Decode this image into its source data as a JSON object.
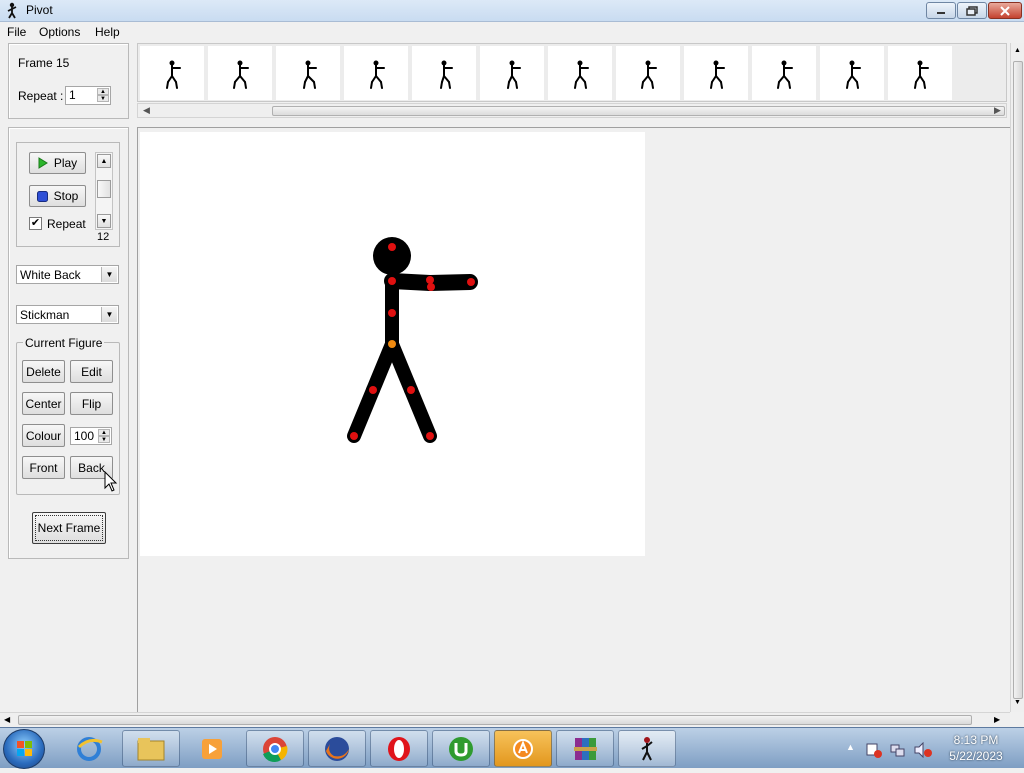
{
  "window": {
    "title": "Pivot"
  },
  "menu": [
    "File",
    "Options",
    "Help"
  ],
  "frame_panel": {
    "frame_label": "Frame 15",
    "repeat_label": "Repeat :",
    "repeat_value": "1"
  },
  "playback": {
    "play": "Play",
    "stop": "Stop",
    "repeat_checkbox": "Repeat",
    "repeat_checked": true,
    "speed_value": "12"
  },
  "background_select": {
    "value": "White Back"
  },
  "figure_select": {
    "value": "Stickman"
  },
  "current_figure": {
    "legend": "Current Figure",
    "delete": "Delete",
    "edit": "Edit",
    "center": "Center",
    "flip": "Flip",
    "colour": "Colour",
    "opacity_value": "100",
    "front": "Front",
    "back": "Back"
  },
  "next_frame": "Next Frame",
  "timeline": {
    "thumbnail_count": 12
  },
  "figure_colors": {
    "body": "#000000",
    "joint": "#e01010",
    "origin": "#f08a10"
  },
  "taskbar": {
    "apps": [
      "internet-explorer-icon",
      "file-explorer-icon",
      "media-player-icon",
      "chrome-icon",
      "firefox-icon",
      "opera-icon",
      "utorrent-icon",
      "avast-icon",
      "winrar-icon",
      "pivot-icon"
    ],
    "time": "8:13 PM",
    "date": "5/22/2023"
  }
}
